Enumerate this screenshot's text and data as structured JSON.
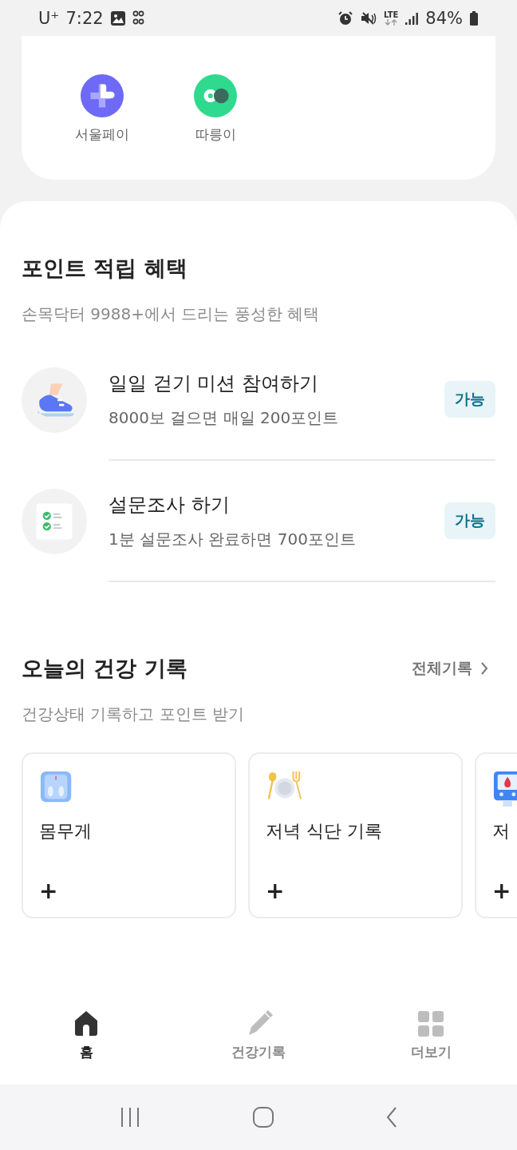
{
  "status_bar": {
    "carrier": "U⁺",
    "time": "7:22",
    "network": "LTE",
    "battery": "84%"
  },
  "shortcuts": [
    {
      "kind": "pay",
      "label": "서울페이"
    },
    {
      "kind": "bike",
      "label": "따릉이"
    }
  ],
  "points": {
    "title": "포인트 적립 혜택",
    "subtitle": "손목닥터 9988+에서 드리는 풍성한 혜택",
    "items": [
      {
        "kind": "walk",
        "title": "일일 걷기 미션 참여하기",
        "desc": "8000보 걸으면 매일 200포인트",
        "badge": "가능"
      },
      {
        "kind": "survey",
        "title": "설문조사 하기",
        "desc": "1분 설문조사 완료하면 700포인트",
        "badge": "가능"
      }
    ]
  },
  "health": {
    "title": "오늘의 건강 기록",
    "link": "전체기록",
    "subtitle": "건강상태 기록하고 포인트 받기",
    "cards": [
      {
        "kind": "scale",
        "label": "몸무게",
        "add": "+"
      },
      {
        "kind": "meal",
        "label": "저녁 식단 기록",
        "add": "+"
      },
      {
        "kind": "glucose",
        "label": "저",
        "add": "+"
      }
    ]
  },
  "nav": [
    {
      "kind": "home",
      "label": "홈",
      "selected": true
    },
    {
      "kind": "pencil",
      "label": "건강기록",
      "selected": false
    },
    {
      "kind": "grid",
      "label": "더보기",
      "selected": false
    }
  ]
}
